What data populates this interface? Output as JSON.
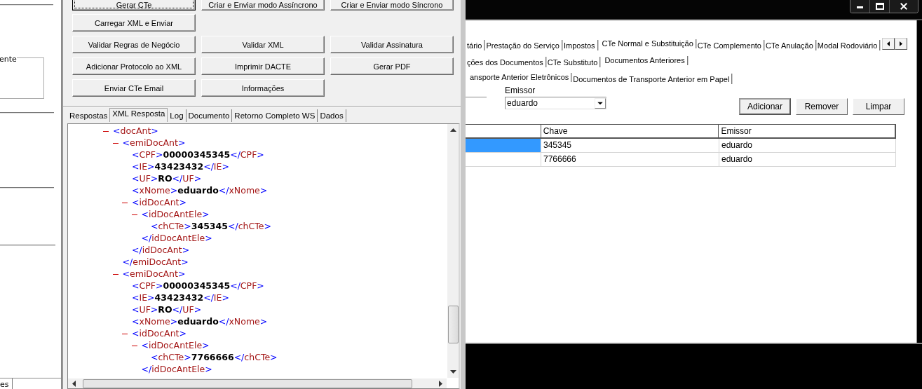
{
  "left_panel": {
    "group_label": "ente",
    "tab": "es"
  },
  "main_window": {
    "button_rows": [
      [
        {
          "label": "Gerar CTe",
          "focused": true
        },
        {
          "label": "Criar e Enviar modo Assíncrono",
          "focused": false
        },
        {
          "label": "Criar e Enviar modo Síncrono",
          "focused": false
        }
      ],
      [
        {
          "label": "Carregar XML e Enviar",
          "focused": false
        }
      ],
      [
        {
          "label": "Validar Regras de Negócio",
          "focused": false
        },
        {
          "label": "Validar XML",
          "focused": false
        },
        {
          "label": "Validar Assinatura",
          "focused": false
        }
      ],
      [
        {
          "label": "Adicionar Protocolo ao XML",
          "focused": false
        },
        {
          "label": "Imprimir DACTE",
          "focused": false
        },
        {
          "label": "Gerar PDF",
          "focused": false
        }
      ],
      [
        {
          "label": "Enviar CTe Email",
          "focused": false
        },
        {
          "label": "Informações",
          "focused": false
        }
      ]
    ],
    "tabs": [
      {
        "label": "Respostas",
        "selected": false
      },
      {
        "label": "XML Resposta",
        "selected": true
      },
      {
        "label": "Log",
        "selected": false
      },
      {
        "label": "Documento",
        "selected": false
      },
      {
        "label": "Retorno Completo WS",
        "selected": false
      },
      {
        "label": "Dados",
        "selected": false
      }
    ],
    "xml_tree": [
      {
        "open": "<docAnt>",
        "expanded": true,
        "children": [
          {
            "open": "<emiDocAnt>",
            "expanded": true,
            "close": "</emiDocAnt>",
            "children": [
              {
                "open": "<CPF>",
                "value": "00000345345",
                "close": "</CPF>"
              },
              {
                "open": "<IE>",
                "value": "43423432",
                "close": "</IE>"
              },
              {
                "open": "<UF>",
                "value": "RO",
                "close": "</UF>"
              },
              {
                "open": "<xNome>",
                "value": "eduardo",
                "close": "</xNome>"
              },
              {
                "open": "<idDocAnt>",
                "expanded": true,
                "close": "</idDocAnt>",
                "children": [
                  {
                    "open": "<idDocAntEle>",
                    "expanded": true,
                    "close": "</idDocAntEle>",
                    "children": [
                      {
                        "open": "<chCTe>",
                        "value": "345345",
                        "close": "</chCTe>"
                      }
                    ]
                  }
                ]
              }
            ]
          },
          {
            "open": "<emiDocAnt>",
            "expanded": true,
            "children": [
              {
                "open": "<CPF>",
                "value": "00000345345",
                "close": "</CPF>"
              },
              {
                "open": "<IE>",
                "value": "43423432",
                "close": "</IE>"
              },
              {
                "open": "<UF>",
                "value": "RO",
                "close": "</UF>"
              },
              {
                "open": "<xNome>",
                "value": "eduardo",
                "close": "</xNome>"
              },
              {
                "open": "<idDocAnt>",
                "expanded": true,
                "children": [
                  {
                    "open": "<idDocAntEle>",
                    "expanded": true,
                    "close": "</idDocAntEle>",
                    "children": [
                      {
                        "open": "<chCTe>",
                        "value": "7766666",
                        "close": "</chCTe>"
                      }
                    ]
                  }
                ]
              }
            ]
          }
        ]
      }
    ]
  },
  "form_window": {
    "main_tabs": [
      {
        "label": "tário",
        "selected": false
      },
      {
        "label": "Prestação do Serviço",
        "selected": false
      },
      {
        "label": "Impostos",
        "selected": false
      },
      {
        "label": "CTe Normal e Substituição",
        "selected": true
      },
      {
        "label": "CTe Complemento",
        "selected": false
      },
      {
        "label": "CTe Anulação",
        "selected": false
      },
      {
        "label": "Modal Rodoviário",
        "selected": false
      }
    ],
    "sub_tabs": [
      {
        "label": "ções dos Documentos",
        "selected": false
      },
      {
        "label": "CTe Substituto",
        "selected": false
      },
      {
        "label": "Documentos Anteriores",
        "selected": true
      }
    ],
    "inner_tabs": [
      {
        "label": "ansporte Anterior Eletrônicos",
        "selected": true
      },
      {
        "label": "Documentos de Transporte  Anterior em Papel",
        "selected": false
      }
    ],
    "emissor": {
      "label": "Emissor",
      "value": "eduardo"
    },
    "buttons": [
      {
        "label": "Adicionar",
        "default": true
      },
      {
        "label": "Remover",
        "default": false
      },
      {
        "label": "Limpar",
        "default": false
      }
    ],
    "table": {
      "columns": [
        "",
        "Chave",
        "Emissor"
      ],
      "rows": [
        {
          "selected": true,
          "cells": [
            "",
            "345345",
            "eduardo"
          ]
        },
        {
          "selected": false,
          "cells": [
            "",
            "7766666",
            "eduardo"
          ]
        }
      ]
    }
  }
}
